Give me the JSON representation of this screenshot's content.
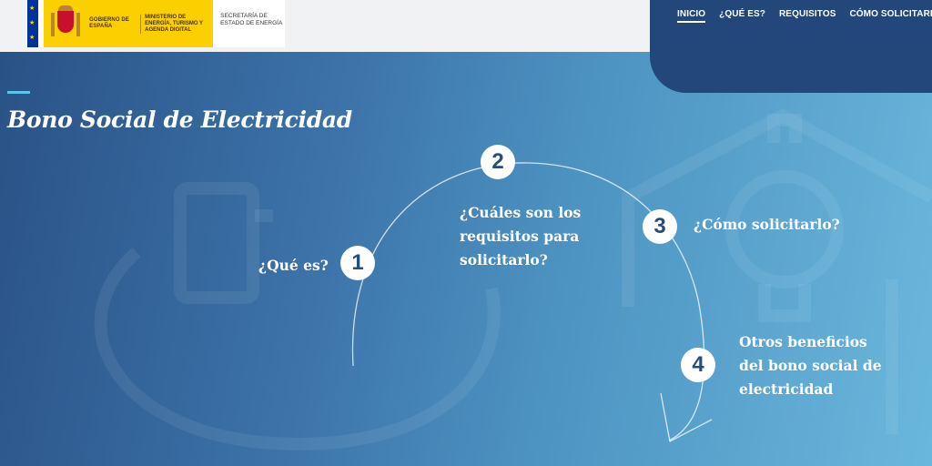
{
  "header": {
    "gov_label": "GOBIERNO DE ESPAÑA",
    "ministry_label": "MINISTERIO DE ENERGÍA, TURISMO Y AGENDA DIGITAL",
    "secretary_label": "SECRETARÍA DE ESTADO DE ENERGÍA"
  },
  "nav": {
    "items": [
      {
        "label": "INICIO"
      },
      {
        "label": "¿QUÉ ES?"
      },
      {
        "label": "REQUISITOS"
      },
      {
        "label": "CÓMO SOLICITARLO"
      }
    ]
  },
  "hero": {
    "title": "Bono Social de Electricidad"
  },
  "steps": [
    {
      "number": "1",
      "label": "¿Qué es?"
    },
    {
      "number": "2",
      "label": "¿Cuáles son los requisitos para solicitarlo?"
    },
    {
      "number": "3",
      "label": "¿Cómo solicitarlo?"
    },
    {
      "number": "4",
      "label": "Otros beneficios del bono social de electricidad"
    }
  ],
  "colors": {
    "nav_tab": "#23477a",
    "hero_start": "#2a5287",
    "hero_end": "#6ab7dc",
    "accent": "#5cc4ea",
    "gov_yellow": "#fcd000"
  }
}
